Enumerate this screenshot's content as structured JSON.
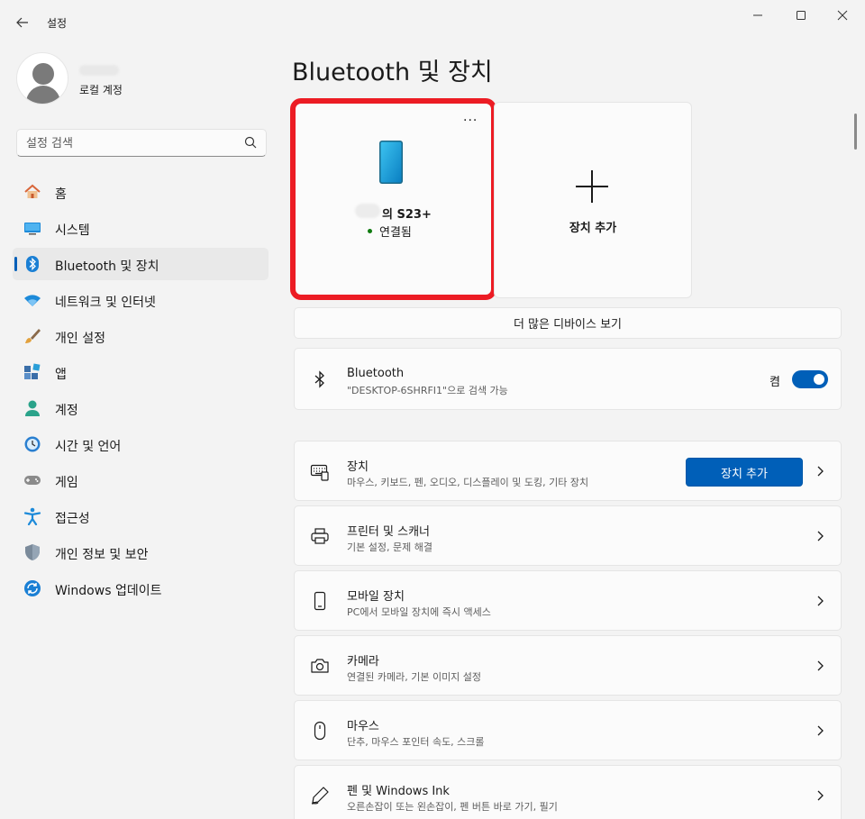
{
  "window": {
    "title": "설정",
    "back_icon": "back-arrow-icon",
    "controls": [
      "minimize-icon",
      "maximize-icon",
      "close-icon"
    ]
  },
  "profile": {
    "account_type": "로컬 계정"
  },
  "search": {
    "placeholder": "설정 검색"
  },
  "sidebar": {
    "items": [
      {
        "label": "홈",
        "icon": "home-icon"
      },
      {
        "label": "시스템",
        "icon": "system-icon"
      },
      {
        "label": "Bluetooth 및 장치",
        "icon": "bluetooth-icon",
        "active": true
      },
      {
        "label": "네트워크 및 인터넷",
        "icon": "wifi-icon"
      },
      {
        "label": "개인 설정",
        "icon": "brush-icon"
      },
      {
        "label": "앱",
        "icon": "apps-icon"
      },
      {
        "label": "계정",
        "icon": "account-icon"
      },
      {
        "label": "시간 및 언어",
        "icon": "time-language-icon"
      },
      {
        "label": "게임",
        "icon": "gamepad-icon"
      },
      {
        "label": "접근성",
        "icon": "accessibility-icon"
      },
      {
        "label": "개인 정보 및 보안",
        "icon": "shield-icon"
      },
      {
        "label": "Windows 업데이트",
        "icon": "update-icon"
      }
    ]
  },
  "main": {
    "title": "Bluetooth 및 장치",
    "device_card": {
      "name": "의 S23+",
      "status": "연결됨",
      "more": "···"
    },
    "add_card": {
      "label": "장치 추가"
    },
    "more_devices": "더 많은 디바이스 보기",
    "bluetooth": {
      "title": "Bluetooth",
      "subtitle": "\"DESKTOP-6SHRFI1\"으로 검색 가능",
      "toggle_label": "켬",
      "toggle_on": true
    },
    "rows": [
      {
        "title": "장치",
        "subtitle": "마우스, 키보드, 펜, 오디오, 디스플레이 및 도킹, 기타 장치",
        "icon": "keyboard-icon",
        "button": "장치 추가"
      },
      {
        "title": "프린터 및 스캐너",
        "subtitle": "기본 설정, 문제 해결",
        "icon": "printer-icon"
      },
      {
        "title": "모바일 장치",
        "subtitle": "PC에서 모바일 장치에 즉시 액세스",
        "icon": "mobile-icon"
      },
      {
        "title": "카메라",
        "subtitle": "연결된 카메라, 기본 이미지 설정",
        "icon": "camera-icon"
      },
      {
        "title": "마우스",
        "subtitle": "단추, 마우스 포인터 속도, 스크롤",
        "icon": "mouse-icon"
      },
      {
        "title": "펜 및 Windows Ink",
        "subtitle": "오른손잡이 또는 왼손잡이, 펜 버튼 바로 가기, 필기",
        "icon": "pen-icon"
      }
    ]
  },
  "colors": {
    "accent": "#005fb8",
    "highlight": "#ec1c24",
    "background": "#f3f3f3",
    "card": "#fbfbfb"
  }
}
